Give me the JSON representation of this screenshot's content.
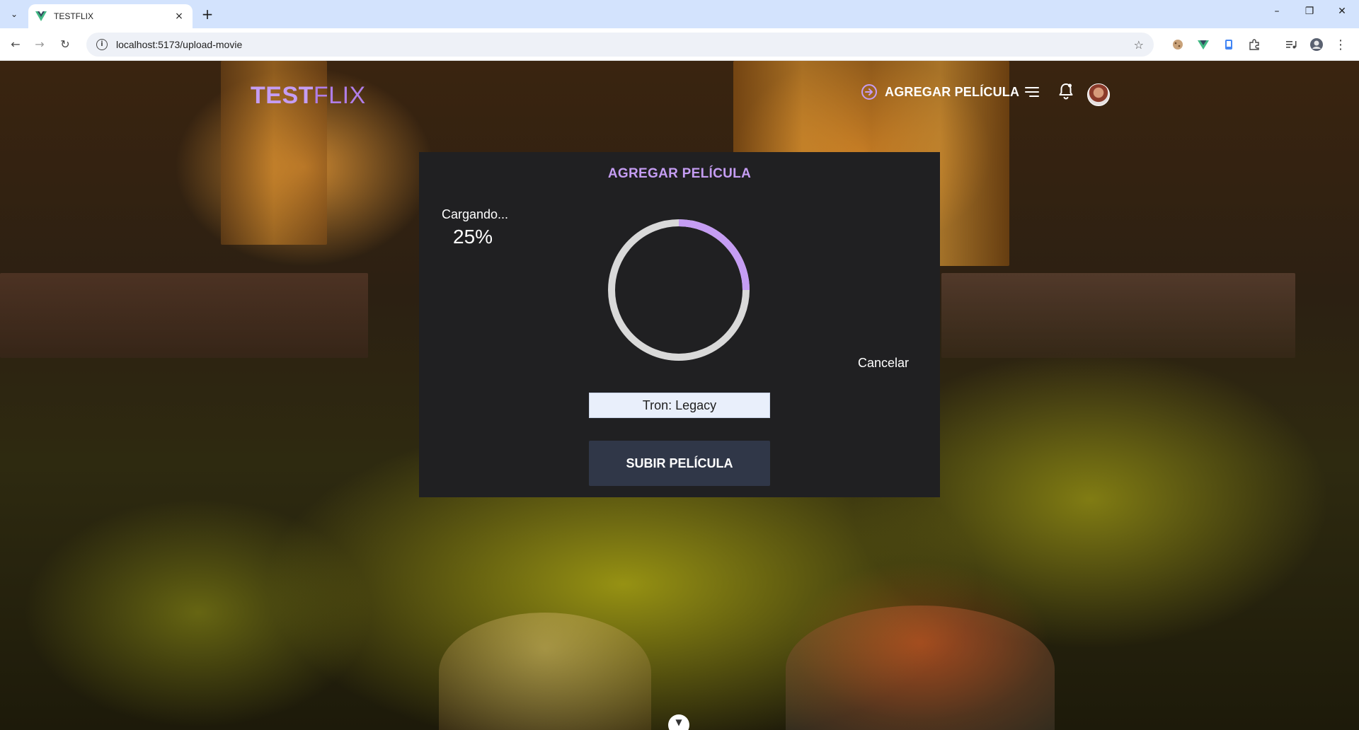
{
  "browser": {
    "tab_title": "TESTFLIX",
    "url": "localhost:5173/upload-movie",
    "new_tab_glyph": "+",
    "close_glyph": "×",
    "minimize_glyph": "–",
    "restore_glyph": "❐",
    "window_close_glyph": "✕"
  },
  "header": {
    "brand_part1": "TEST",
    "brand_part2": "FLIX",
    "add_movie_label": "AGREGAR PELÍCULA",
    "icons": [
      "arrow-circle-right-icon",
      "menu-icon",
      "bell-icon",
      "avatar"
    ]
  },
  "modal": {
    "title": "AGREGAR PELÍCULA",
    "loading_label": "Cargando...",
    "progress_label": "25%",
    "progress_fraction": 0.25,
    "cancel_label": "Cancelar",
    "movie_title_value": "Tron: Legacy",
    "submit_label": "SUBIR PELÍCULA"
  },
  "colors": {
    "accent": "#c59df3",
    "modal_bg": "#202022",
    "ring_track": "#d9d9d9",
    "button_bg": "#303748",
    "input_bg": "#e9effb"
  }
}
